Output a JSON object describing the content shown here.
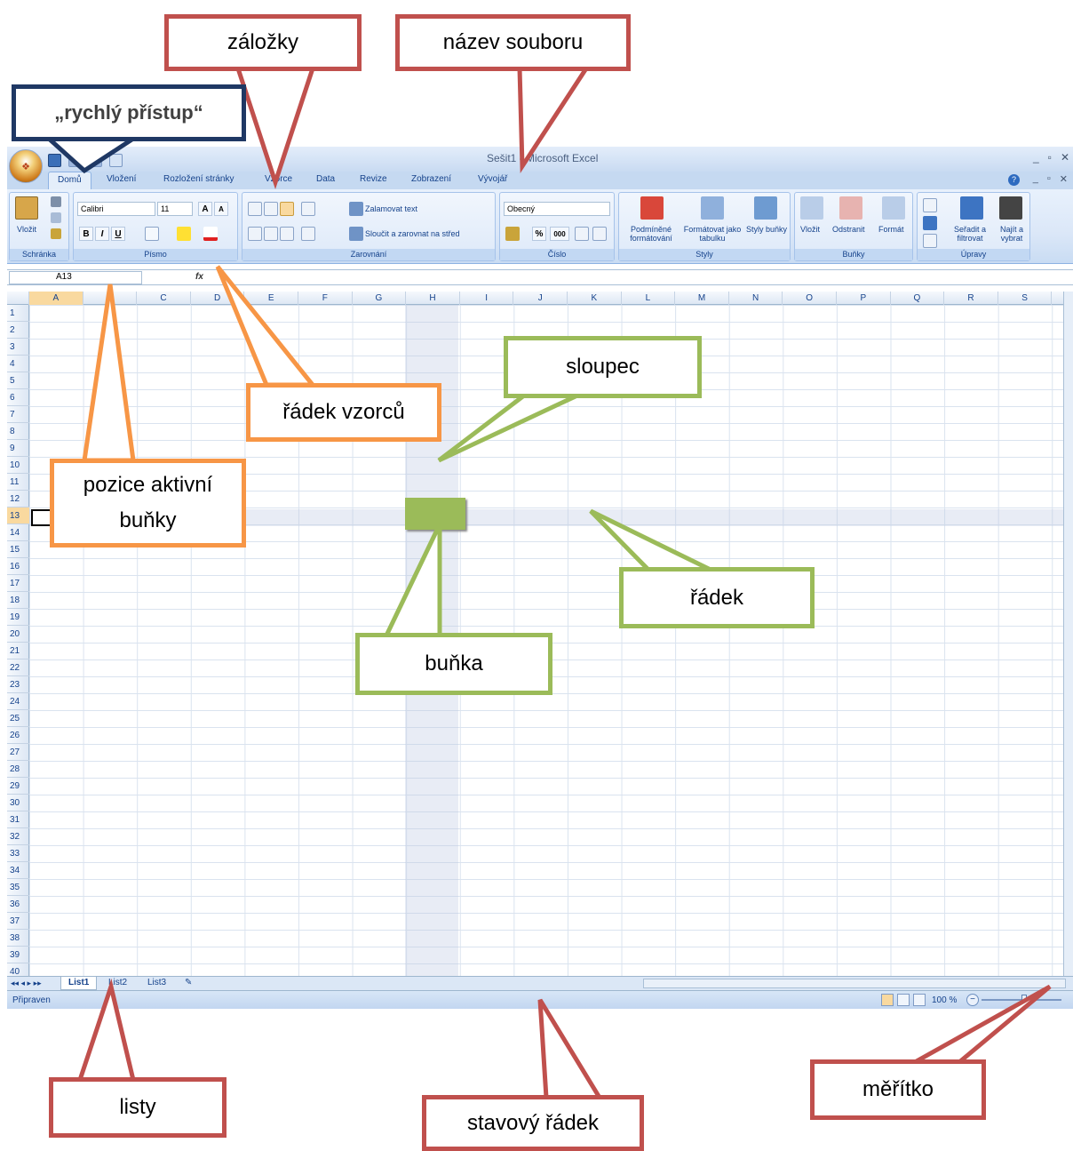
{
  "window": {
    "title": "Sešit1 - Microsoft Excel",
    "office_button": "",
    "controls": [
      "_",
      "▫",
      "✕"
    ]
  },
  "tabs": [
    "Domů",
    "Vložení",
    "Rozložení stránky",
    "Vzorce",
    "Data",
    "Revize",
    "Zobrazení",
    "Vývojář"
  ],
  "ribbon": {
    "clipboard": {
      "label": "Schránka",
      "paste": "Vložit"
    },
    "font": {
      "label": "Písmo",
      "font_name": "Calibri",
      "font_size": "11",
      "bold": "B",
      "italic": "I",
      "underline": "U"
    },
    "alignment": {
      "label": "Zarovnání",
      "wrap": "Zalamovat text",
      "merge": "Sloučit a zarovnat na střed"
    },
    "number": {
      "label": "Číslo",
      "format": "Obecný",
      "percent": "%",
      "thousands": "000"
    },
    "styles": {
      "label": "Styly",
      "conditional": "Podmíněné formátování",
      "as_table": "Formátovat jako tabulku",
      "cell_styles": "Styly buňky"
    },
    "cells": {
      "label": "Buňky",
      "insert": "Vložit",
      "delete": "Odstranit",
      "format": "Formát"
    },
    "editing": {
      "label": "Úpravy",
      "sort": "Seřadit a filtrovat",
      "find": "Najít a vybrat"
    }
  },
  "formula_bar": {
    "name_box": "A13",
    "fx": "fx"
  },
  "columns": [
    "A",
    "B",
    "C",
    "D",
    "E",
    "F",
    "G",
    "H",
    "I",
    "J",
    "K",
    "L",
    "M",
    "N",
    "O",
    "P",
    "Q",
    "R",
    "S"
  ],
  "rows": [
    "1",
    "2",
    "3",
    "4",
    "5",
    "6",
    "7",
    "8",
    "9",
    "10",
    "11",
    "12",
    "13",
    "14",
    "15",
    "16",
    "17",
    "18",
    "19",
    "20",
    "21",
    "22",
    "23",
    "24",
    "25",
    "26",
    "27",
    "28",
    "29",
    "30",
    "31",
    "32",
    "33",
    "34",
    "35",
    "36",
    "37",
    "38",
    "39",
    "40"
  ],
  "active_cell": {
    "column": "A",
    "row": "13"
  },
  "sheets": {
    "nav": "◂◂ ◂ ▸ ▸▸",
    "tabs": [
      "List1",
      "List2",
      "List3"
    ],
    "active": "List1"
  },
  "status": {
    "ready": "Připraven",
    "zoom": "100 %",
    "zoom_minus": "−"
  },
  "callouts": {
    "quick_access": "„rychlý přístup“",
    "tabs": "záložky",
    "file_name": "název souboru",
    "formula_row": "řádek vzorců",
    "active_position": "pozice aktivní buňky",
    "column": "sloupec",
    "row": "řádek",
    "cell": "buňka",
    "sheets": "listy",
    "status_row": "stavový řádek",
    "scale": "měřítko"
  },
  "colors": {
    "red": "#c0504d",
    "orange": "#f79646",
    "green": "#9bbb59",
    "navy": "#1f3864",
    "ribbon": "#dbe7f8"
  }
}
